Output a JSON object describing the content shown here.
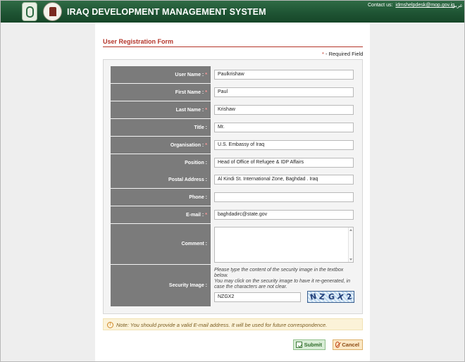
{
  "header": {
    "title": "IRAQ DEVELOPMENT MANAGEMENT SYSTEM",
    "contact_label": "Contact us:",
    "contact_email": "idmshelpdesk@mop.gov.iq",
    "language_link": "عربي"
  },
  "form": {
    "title": "User Registration Form",
    "required_star": "*",
    "required_note": " - Required Field",
    "fields": [
      {
        "label": "User Name :",
        "required": true,
        "value": "Paulkrishaw"
      },
      {
        "label": "First Name :",
        "required": true,
        "value": "Paul"
      },
      {
        "label": "Last Name :",
        "required": true,
        "value": "Krishaw"
      },
      {
        "label": "Title :",
        "required": false,
        "value": "Mr."
      },
      {
        "label": "Organisation :",
        "required": true,
        "value": "U.S. Embassy of  Iraq"
      },
      {
        "label": "Position :",
        "required": false,
        "value": "Head of Office of Refugee & IDP Affairs"
      },
      {
        "label": "Postal Address :",
        "required": false,
        "value": "Al Kindi St. International Zone, Baghdad . Iraq"
      },
      {
        "label": "Phone :",
        "required": false,
        "value": ""
      },
      {
        "label": "E-mail :",
        "required": true,
        "value": "baghdadirc@state.gov"
      }
    ],
    "comment": {
      "label": "Comment :",
      "value": ""
    },
    "security": {
      "label": "Security Image :",
      "instructions": "Please type the content of the security image in the textbox below.\nYou may click on the security image to have it re-generated, in case the characters are not clear.",
      "input_value": "NZGX2",
      "image_text": "NZGX2"
    }
  },
  "note": {
    "text": "Note: You should provide a valid E-mail address. It will be used for future correspondence."
  },
  "buttons": {
    "submit": "Submit",
    "cancel": "Cancel"
  },
  "colors": {
    "header_green": "#1f5534",
    "accent_red": "#b4352a",
    "label_gray": "#7b7b7b"
  }
}
